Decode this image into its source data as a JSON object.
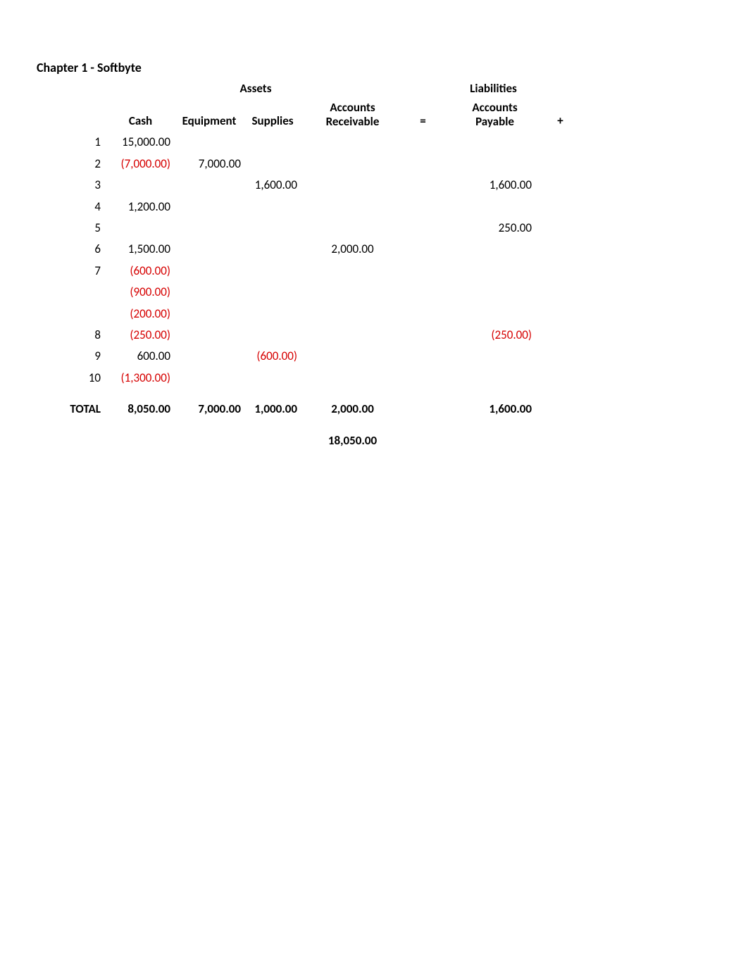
{
  "title": "Chapter 1 - Softbyte",
  "sections": {
    "assets": "Assets",
    "liabilities": "Liabilities"
  },
  "headers": {
    "cash": "Cash",
    "equipment": "Equipment",
    "supplies": "Supplies",
    "ar1": "Accounts",
    "ar2": "Receivable",
    "eq": "=",
    "ap1": "Accounts",
    "ap2": "Payable",
    "plus": "+"
  },
  "rows": [
    {
      "n": "1",
      "cash": "15,000.00"
    },
    {
      "n": "2",
      "cash": "(7,000.00)",
      "cash_neg": true,
      "equip": "7,000.00"
    },
    {
      "n": "3",
      "supplies": "1,600.00",
      "ap": "1,600.00"
    },
    {
      "n": "4",
      "cash": "1,200.00"
    },
    {
      "n": "5",
      "ap": "250.00"
    },
    {
      "n": "6",
      "cash": "1,500.00",
      "ar": "2,000.00"
    },
    {
      "n": "7",
      "cash": "(600.00)",
      "cash_neg": true
    },
    {
      "n": "",
      "cash": "(900.00)",
      "cash_neg": true
    },
    {
      "n": "",
      "cash": "(200.00)",
      "cash_neg": true
    },
    {
      "n": "8",
      "cash": "(250.00)",
      "cash_neg": true,
      "ap": "(250.00)",
      "ap_neg": true
    },
    {
      "n": "9",
      "cash": "600.00",
      "supplies": "(600.00)",
      "supplies_neg": true
    },
    {
      "n": "10",
      "cash": "(1,300.00)",
      "cash_neg": true
    }
  ],
  "totals": {
    "label": "TOTAL",
    "cash": "8,050.00",
    "equip": "7,000.00",
    "supplies": "1,000.00",
    "ar": "2,000.00",
    "ap": "1,600.00"
  },
  "grand": "18,050.00",
  "chart_data": {
    "type": "table",
    "title": "Chapter 1 - Softbyte",
    "columns": [
      "Row",
      "Cash",
      "Equipment",
      "Supplies",
      "Accounts Receivable",
      "=",
      "Accounts Payable",
      "+"
    ],
    "sections": {
      "Assets": [
        "Cash",
        "Equipment",
        "Supplies",
        "Accounts Receivable"
      ],
      "Liabilities": [
        "Accounts Payable"
      ]
    },
    "rows": [
      {
        "Row": 1,
        "Cash": 15000.0
      },
      {
        "Row": 2,
        "Cash": -7000.0,
        "Equipment": 7000.0
      },
      {
        "Row": 3,
        "Supplies": 1600.0,
        "Accounts Payable": 1600.0
      },
      {
        "Row": 4,
        "Cash": 1200.0
      },
      {
        "Row": 5,
        "Accounts Payable": 250.0
      },
      {
        "Row": 6,
        "Cash": 1500.0,
        "Accounts Receivable": 2000.0
      },
      {
        "Row": 7,
        "Cash": -600.0
      },
      {
        "Row": null,
        "Cash": -900.0
      },
      {
        "Row": null,
        "Cash": -200.0
      },
      {
        "Row": 8,
        "Cash": -250.0,
        "Accounts Payable": -250.0
      },
      {
        "Row": 9,
        "Cash": 600.0,
        "Supplies": -600.0
      },
      {
        "Row": 10,
        "Cash": -1300.0
      }
    ],
    "totals": {
      "Cash": 8050.0,
      "Equipment": 7000.0,
      "Supplies": 1000.0,
      "Accounts Receivable": 2000.0,
      "Accounts Payable": 1600.0
    },
    "grand_total_assets": 18050.0
  }
}
